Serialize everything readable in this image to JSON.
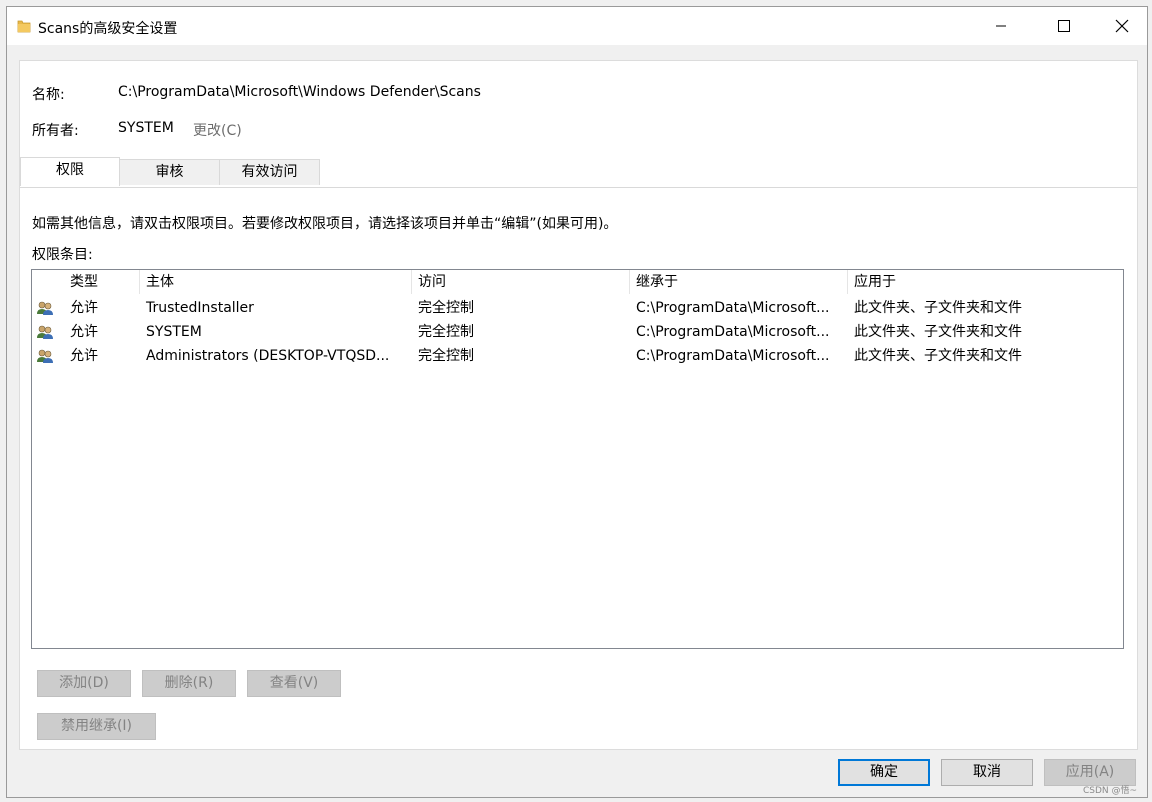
{
  "window": {
    "title": "Scans的高级安全设置"
  },
  "info": {
    "name_label": "名称:",
    "name_value": "C:\\ProgramData\\Microsoft\\Windows Defender\\Scans",
    "owner_label": "所有者:",
    "owner_value": "SYSTEM",
    "change_link": "更改(C)"
  },
  "tabs": [
    {
      "label": "权限",
      "active": true
    },
    {
      "label": "审核",
      "active": false
    },
    {
      "label": "有效访问",
      "active": false
    }
  ],
  "hint": "如需其他信息，请双击权限项目。若要修改权限项目，请选择该项目并单击“编辑”(如果可用)。",
  "entries_label": "权限条目:",
  "table": {
    "columns": [
      "类型",
      "主体",
      "访问",
      "继承于",
      "应用于"
    ],
    "rows": [
      {
        "type": "允许",
        "principal": "TrustedInstaller",
        "access": "完全控制",
        "inherited": "C:\\ProgramData\\Microsoft...",
        "applies": "此文件夹、子文件夹和文件"
      },
      {
        "type": "允许",
        "principal": "SYSTEM",
        "access": "完全控制",
        "inherited": "C:\\ProgramData\\Microsoft...",
        "applies": "此文件夹、子文件夹和文件"
      },
      {
        "type": "允许",
        "principal": "Administrators (DESKTOP-VTQSD...",
        "access": "完全控制",
        "inherited": "C:\\ProgramData\\Microsoft...",
        "applies": "此文件夹、子文件夹和文件"
      }
    ]
  },
  "buttons": {
    "add": "添加(D)",
    "remove": "删除(R)",
    "view": "查看(V)",
    "disable_inheritance": "禁用继承(I)",
    "ok": "确定",
    "cancel": "取消",
    "apply": "应用(A)"
  },
  "watermark": "CSDN @悟~",
  "colors": {
    "accent": "#0078d7",
    "folder": "#e8b84a"
  }
}
